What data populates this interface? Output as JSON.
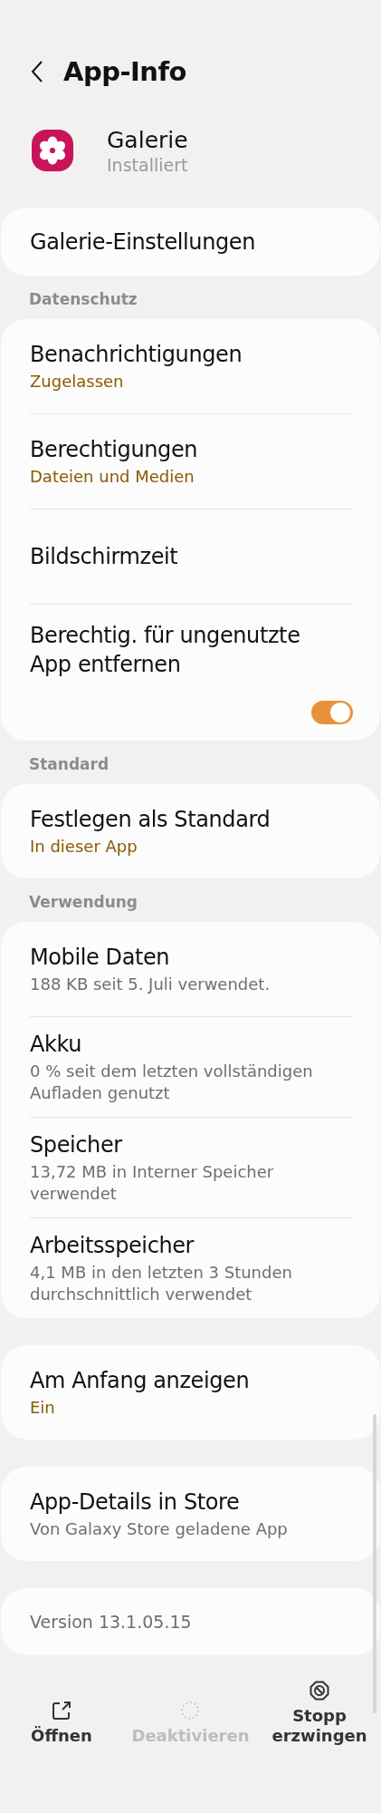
{
  "header": {
    "title": "App-Info"
  },
  "app": {
    "name": "Galerie",
    "status": "Installiert"
  },
  "sections": [
    {
      "items": [
        {
          "kind": "plain",
          "title": "Galerie-Einstellungen"
        }
      ]
    },
    {
      "label": "Datenschutz",
      "items": [
        {
          "kind": "status",
          "title": "Benachrichtigungen",
          "subtitle": "Zugelassen"
        },
        {
          "kind": "status",
          "title": "Berechtigungen",
          "subtitle": "Dateien und Medien"
        },
        {
          "kind": "plain",
          "title": "Bildschirmzeit"
        },
        {
          "kind": "toggle",
          "title": "Berechtig. für ungenutzte App entfernen",
          "on": true
        }
      ]
    },
    {
      "label": "Standard",
      "items": [
        {
          "kind": "status",
          "title": "Festlegen als Standard",
          "subtitle": "In dieser App"
        }
      ]
    },
    {
      "label": "Verwendung",
      "items": [
        {
          "kind": "info",
          "title": "Mobile Daten",
          "subtitle": "188 KB seit 5. Juli verwendet."
        },
        {
          "kind": "info",
          "title": "Akku",
          "subtitle": "0 % seit dem letzten vollständigen Aufladen genutzt"
        },
        {
          "kind": "info",
          "title": "Speicher",
          "subtitle": "13,72 MB in Interner Speicher verwendet"
        },
        {
          "kind": "info",
          "title": "Arbeitsspeicher",
          "subtitle": "4,1 MB in den letzten 3 Stunden durchschnittlich verwendet"
        }
      ]
    },
    {
      "items": [
        {
          "kind": "status",
          "title": "Am Anfang anzeigen",
          "subtitle": "Ein"
        }
      ]
    },
    {
      "items": [
        {
          "kind": "info",
          "title": "App-Details in Store",
          "subtitle": "Von Galaxy Store geladene App"
        }
      ]
    },
    {
      "items": [
        {
          "kind": "version",
          "title": "Version 13.1.05.15"
        }
      ]
    }
  ],
  "actions": [
    {
      "label": "Öffnen",
      "disabled": false
    },
    {
      "label": "Deaktivieren",
      "disabled": true
    },
    {
      "label": "Stopp erzwingen",
      "disabled": false
    }
  ]
}
